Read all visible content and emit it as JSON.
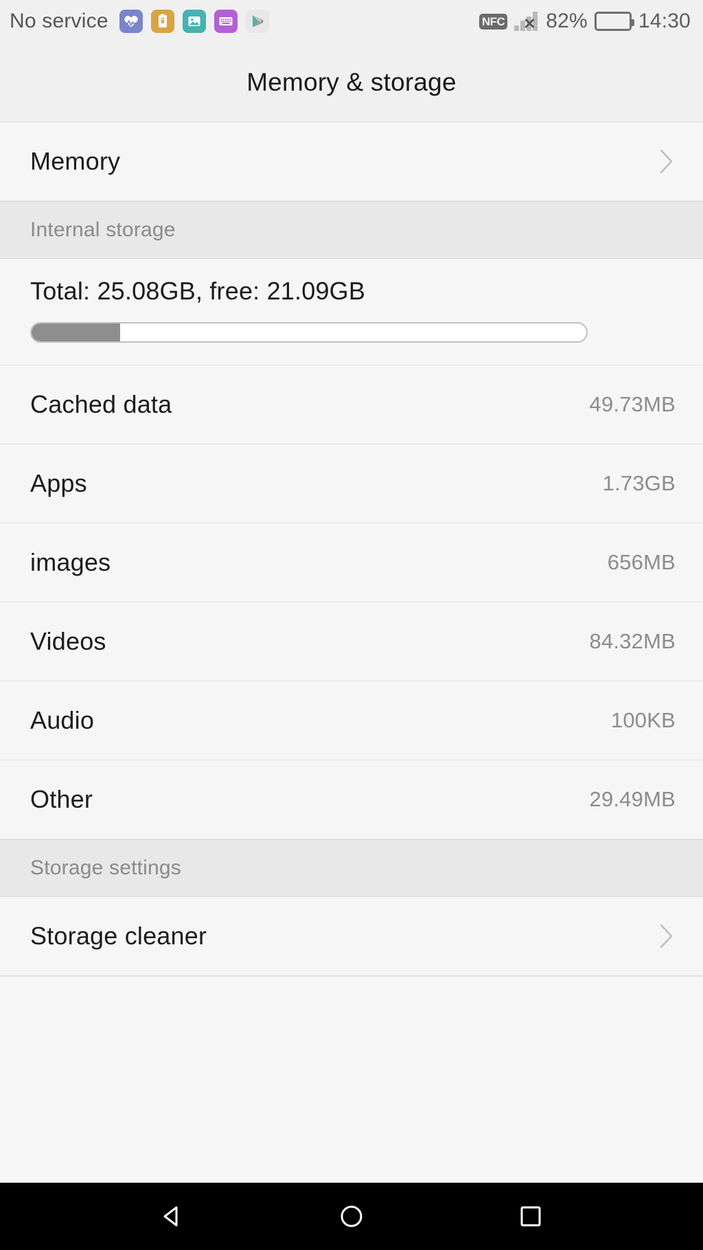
{
  "statusbar": {
    "carrier": "No service",
    "notification_icons": [
      {
        "name": "health-icon",
        "color": "#7986cb"
      },
      {
        "name": "file-lock-icon",
        "color": "#d9a441"
      },
      {
        "name": "gallery-icon",
        "color": "#45b3b0"
      },
      {
        "name": "keyboard-icon",
        "color": "#b45fd6"
      },
      {
        "name": "play-store-icon",
        "color": "#e8e8e8"
      }
    ],
    "nfc_label": "NFC",
    "signal_state": "no-signal",
    "battery_percent": "82%",
    "battery_level": 82,
    "clock": "14:30"
  },
  "header": {
    "title": "Memory & storage"
  },
  "memory_row": {
    "label": "Memory",
    "chevron": "chevron-right-icon"
  },
  "internal_storage": {
    "section_title": "Internal storage",
    "totals_text": "Total: 25.08GB, free: 21.09GB",
    "total_gb": 25.08,
    "free_gb": 21.09,
    "used_percent": 16,
    "items": [
      {
        "label": "Cached data",
        "value": "49.73MB"
      },
      {
        "label": "Apps",
        "value": "1.73GB"
      },
      {
        "label": "images",
        "value": "656MB"
      },
      {
        "label": "Videos",
        "value": "84.32MB"
      },
      {
        "label": "Audio",
        "value": "100KB"
      },
      {
        "label": "Other",
        "value": "29.49MB"
      }
    ]
  },
  "storage_settings": {
    "section_title": "Storage settings",
    "items": [
      {
        "label": "Storage cleaner",
        "chevron": "chevron-right-icon"
      }
    ]
  },
  "navbar": {
    "buttons": [
      {
        "name": "back-button",
        "icon": "back-triangle-icon"
      },
      {
        "name": "home-button",
        "icon": "home-circle-icon"
      },
      {
        "name": "recents-button",
        "icon": "recents-square-icon"
      }
    ]
  },
  "colors": {
    "page_bg": "#f6f6f6",
    "section_bg": "#e8e8e8",
    "statusbar_bg": "#f0f0f0",
    "label": "#1c1c1c",
    "value": "#8c8c8c",
    "progress_fill": "#8e8e8e"
  }
}
